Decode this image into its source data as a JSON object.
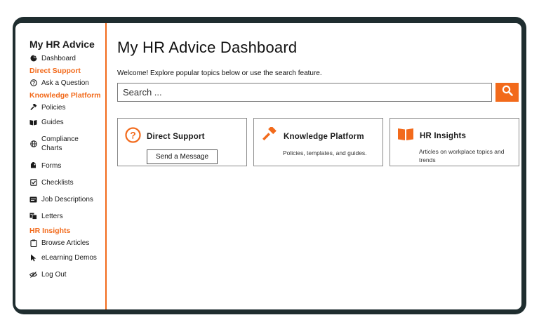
{
  "sidebar": {
    "title": "My HR Advice",
    "dashboard": "Dashboard",
    "sections": {
      "direct_support": "Direct Support",
      "knowledge_platform": "Knowledge Platform",
      "hr_insights": "HR Insights"
    },
    "items": {
      "ask": "Ask a Question",
      "policies": "Policies",
      "guides": "Guides",
      "compliance": "Compliance Charts",
      "forms": "Forms",
      "checklists": "Checklists",
      "jobdesc": "Job Descriptions",
      "letters": "Letters",
      "browse": "Browse Articles",
      "elearning": "eLearning Demos",
      "logout": "Log Out"
    }
  },
  "main": {
    "title": "My HR Advice Dashboard",
    "welcome": "Welcome! Explore popular topics below or use the search feature.",
    "search_placeholder": "Search ...",
    "cards": {
      "direct": {
        "title": "Direct Support",
        "button": "Send a Message"
      },
      "knowledge": {
        "title": "Knowledge Platform",
        "desc": "Policies, templates, and guides."
      },
      "insights": {
        "title": "HR Insights",
        "desc": "Articles on workplace topics and trends"
      }
    }
  },
  "colors": {
    "accent": "#f26a1b",
    "frame": "#1f2d2f"
  },
  "icons": [
    "pie-chart-icon",
    "question-icon",
    "gavel-icon",
    "book-icon",
    "globe-icon",
    "tag-icon",
    "checkbox-icon",
    "id-card-icon",
    "letters-icon",
    "clipboard-icon",
    "cursor-icon",
    "eye-slash-icon",
    "search-icon"
  ]
}
